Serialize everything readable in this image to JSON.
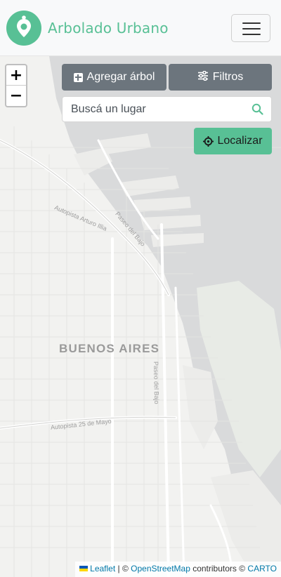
{
  "navbar": {
    "brand_name": "Arbolado Urbano",
    "brand_color": "#58c095",
    "menu_icon": "hamburger-menu-icon"
  },
  "map": {
    "zoom_in_label": "+",
    "zoom_out_label": "−",
    "city_label": "BUENOS AIRES",
    "street_labels": [
      "Autopista Arturo Illia",
      "Paseo del Bajo",
      "Paseo del Bajo",
      "Autopista 25 de Mayo"
    ],
    "attribution": {
      "leaflet": "Leaflet",
      "separator": " | © ",
      "osm": "OpenStreetMap",
      "contributors": " contributors © ",
      "carto": "CARTO"
    }
  },
  "toolbar": {
    "add_tree_label": "Agregar árbol",
    "add_tree_icon": "plus-square-icon",
    "filters_label": "Filtros",
    "filters_icon": "sliders-icon",
    "search_placeholder": "Buscá un lugar",
    "search_icon": "search-icon",
    "locate_label": "Localizar",
    "locate_icon": "crosshairs-icon"
  },
  "colors": {
    "primary": "#58c095",
    "secondary_button": "#6c757d",
    "map_land": "#f2f2f0",
    "map_water": "#d9dadb"
  }
}
